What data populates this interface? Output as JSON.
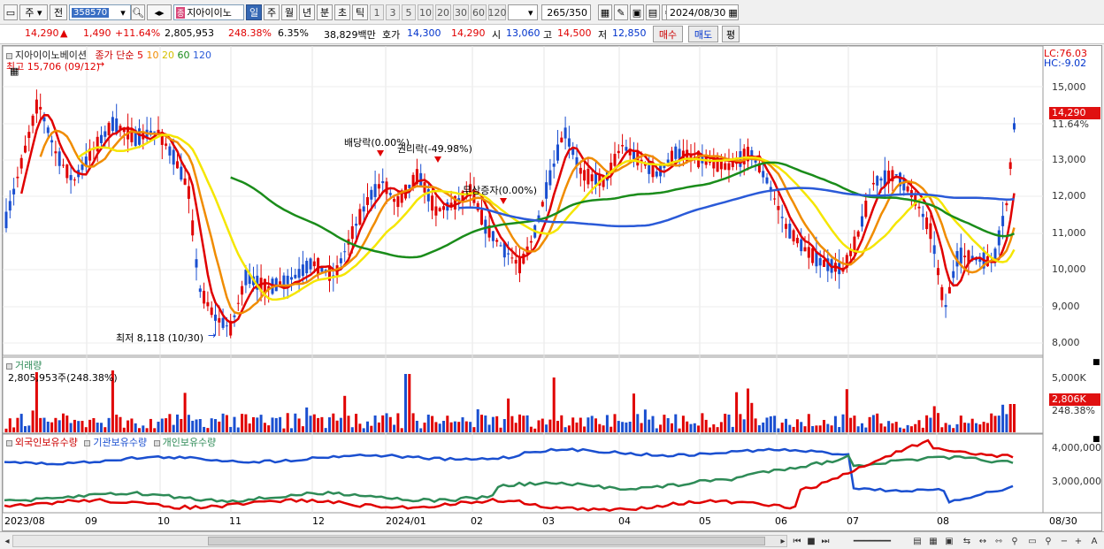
{
  "toolbar": {
    "period_main": "주",
    "prev": "전",
    "code": "358570",
    "tag": "종",
    "name": "지아이이노",
    "periods": [
      "일",
      "주",
      "월",
      "년",
      "분",
      "초",
      "틱"
    ],
    "active_period": "일",
    "minutes": [
      "1",
      "3",
      "5",
      "10",
      "20",
      "30",
      "60",
      "120"
    ],
    "count": "265",
    "count_total": "/350",
    "date": "2024/08/30"
  },
  "quote": {
    "price": "14,290",
    "change": "1,490",
    "pct": "+11.64%",
    "volume": "2,805,953",
    "vol_ratio": "248.38%",
    "turnover": "6.35%",
    "amount": "38,829백만",
    "ask_label": "호가",
    "ask": "14,300",
    "bid": "14,290",
    "open_label": "시",
    "open": "13,060",
    "high_label": "고",
    "high": "14,500",
    "low_label": "저",
    "low": "12,850",
    "buy": "매수",
    "sell": "매도",
    "avg": "평"
  },
  "price_pane": {
    "name": "지아이이노베이션",
    "ma_label": "종가 단순",
    "ma_periods": [
      "5",
      "10",
      "20",
      "60",
      "120"
    ],
    "ma_colors": [
      "#e00000",
      "#f08c00",
      "#f5e600",
      "#1a8c1a",
      "#2a5ad8"
    ],
    "hi_marker": "최고 15,706 (09/12)",
    "lo_marker": "최저 8,118 (10/30)",
    "event1": "배당락(0.00%)",
    "event2": "권리락(-49.98%)",
    "event3": "무상증자(0.00%)",
    "lc": "LC:76.03",
    "hc": "HC:-9.02",
    "cur_price": "14,290",
    "cur_pct": "11.64%",
    "yticks": [
      "15,000",
      "14,000",
      "13,000",
      "12,000",
      "11,000",
      "10,000",
      "9,000",
      "8,000"
    ]
  },
  "volume_pane": {
    "title": "거래량",
    "readout": "2,805,953주(248.38%)",
    "ytick": "5,000K",
    "cur": "2,806K",
    "cur_pct": "248.38%"
  },
  "holding_pane": {
    "series": [
      "외국인보유수량",
      "기관보유수량",
      "개인보유수량"
    ],
    "colors": [
      "#e00000",
      "#1a4fd0",
      "#2e8b57"
    ],
    "yticks": [
      "4,000,000",
      "3,000,000"
    ]
  },
  "xaxis": [
    "2023/08",
    "09",
    "10",
    "11",
    "12",
    "2024/01",
    "02",
    "03",
    "04",
    "05",
    "06",
    "07",
    "08",
    "08/30"
  ]
}
